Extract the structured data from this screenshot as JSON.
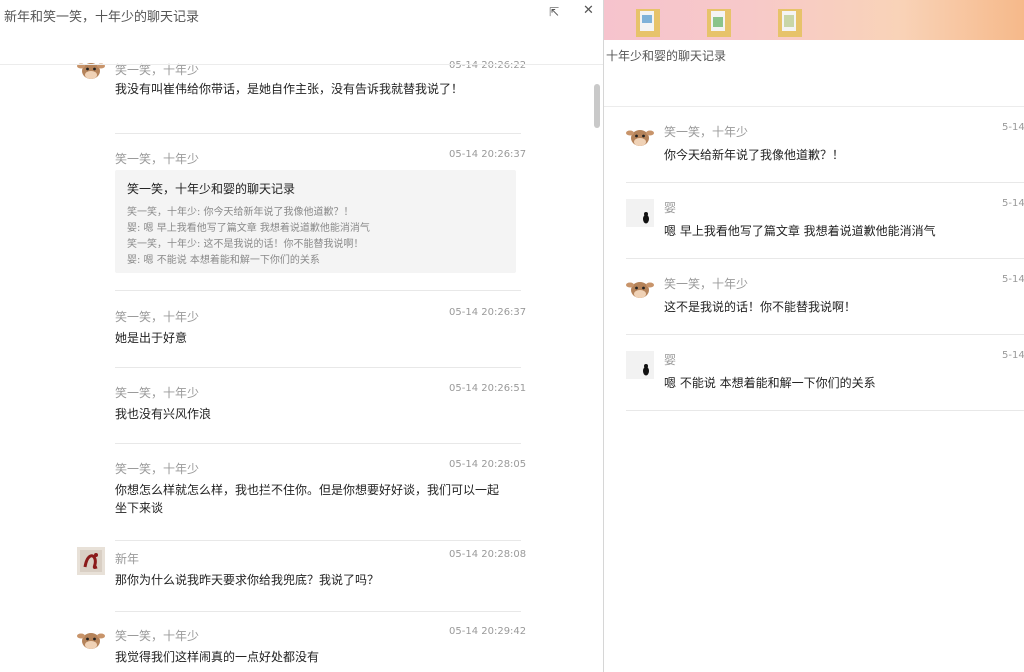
{
  "left_window": {
    "title": "新年和笑一笑，十年少的聊天记录",
    "share_icon": "share-icon",
    "close_icon": "close-icon",
    "messages": [
      {
        "sender": "笑一笑，十年少",
        "time": "05-14 20:26:22",
        "avatar": "cartoon-cow-avatar",
        "text": "我没有叫崔伟给你带话，是她自作主张，没有告诉我就替我说了！"
      },
      {
        "sender": "笑一笑，十年少",
        "time": "05-14 20:26:37",
        "avatar": "none",
        "quote": {
          "title": "笑一笑，十年少和婴的聊天记录",
          "lines": [
            "笑一笑，十年少: 你今天给新年说了我像他道歉？！",
            "婴: 嗯 早上我看他写了篇文章 我想着说道歉他能消消气",
            "笑一笑，十年少: 这不是我说的话！你不能替我说啊！",
            "婴: 嗯 不能说 本想着能和解一下你们的关系"
          ]
        }
      },
      {
        "sender": "笑一笑，十年少",
        "time": "05-14 20:26:37",
        "avatar": "none",
        "text": "她是出于好意"
      },
      {
        "sender": "笑一笑，十年少",
        "time": "05-14 20:26:51",
        "avatar": "none",
        "text": "我也没有兴风作浪"
      },
      {
        "sender": "笑一笑，十年少",
        "time": "05-14 20:28:05",
        "avatar": "none",
        "text": "你想怎么样就怎么样，我也拦不住你。但是你想要好好谈，我们可以一起坐下来谈"
      },
      {
        "sender": "新年",
        "time": "05-14 20:28:08",
        "avatar": "calligraphy-avatar",
        "text": "那你为什么说我昨天要求你给我兜底？我说了吗？"
      },
      {
        "sender": "笑一笑，十年少",
        "time": "05-14 20:29:42",
        "avatar": "cartoon-cow-avatar",
        "text": "我觉得我们这样闹真的一点好处都没有"
      }
    ]
  },
  "right_window": {
    "title": "十年少和婴的聊天记录",
    "messages": [
      {
        "sender": "笑一笑，十年少",
        "time": "5-14",
        "avatar": "cartoon-cow-avatar",
        "text": "你今天给新年说了我像他道歉？！"
      },
      {
        "sender": "婴",
        "time": "5-14",
        "avatar": "dark-figure-avatar",
        "text": "嗯 早上我看他写了篇文章 我想着说道歉他能消消气"
      },
      {
        "sender": "笑一笑，十年少",
        "time": "5-14",
        "avatar": "cartoon-cow-avatar",
        "text": "这不是我说的话！你不能替我说啊！"
      },
      {
        "sender": "婴",
        "time": "5-14",
        "avatar": "dark-figure-avatar",
        "text": "嗯 不能说 本想着能和解一下你们的关系"
      }
    ]
  }
}
